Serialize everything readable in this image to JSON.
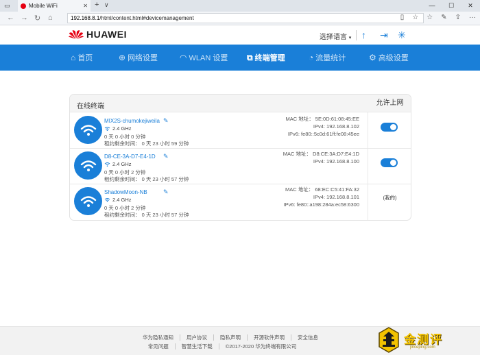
{
  "browser": {
    "tab_title": "Mobile WiFi",
    "new_tab": "+",
    "tab_menu": "∨",
    "url_host": "192.168.8.1",
    "url_path": "/html/content.html#devicemanagement"
  },
  "header": {
    "brand": "HUAWEI",
    "language_select": "选择语言",
    "brand_color": "#1a7fd8"
  },
  "nav": {
    "items": [
      {
        "label": "首页",
        "icon": "home-icon"
      },
      {
        "label": "网络设置",
        "icon": "globe-icon"
      },
      {
        "label": "WLAN 设置",
        "icon": "wifi-icon"
      },
      {
        "label": "终端管理",
        "icon": "devices-icon",
        "active": true
      },
      {
        "label": "流量统计",
        "icon": "traffic-icon"
      },
      {
        "label": "高级设置",
        "icon": "gear-icon"
      }
    ]
  },
  "devices": {
    "title": "在线终端",
    "allow_header": "允许上网",
    "rows": [
      {
        "name": "MIX2S-chumokejiweila",
        "band": "2.4 GHz",
        "online": "0 天 0 小时 0 分钟",
        "lease": "租约剩余时间： 0 天 23 小时 59 分钟",
        "mac": "MAC 地址： 5E:0D:61:08:45:EE",
        "ipv4": "IPv4: 192.168.8.102",
        "ipv6": "IPv6: fe80::5c0d:61ff:fe08:45ee",
        "allowed": true
      },
      {
        "name": "D8-CE-3A-D7-E4-1D",
        "band": "2.4 GHz",
        "online": "0 天 0 小时 2 分钟",
        "lease": "租约剩余时间： 0 天 23 小时 57 分钟",
        "mac": "MAC 地址： D8:CE:3A:D7:E4:1D",
        "ipv4": "IPv4: 192.168.8.100",
        "ipv6": "",
        "allowed": true
      },
      {
        "name": "ShadowMoon-NB",
        "band": "2.4 GHz",
        "online": "0 天 0 小时 2 分钟",
        "lease": "租约剩余时间： 0 天 23 小时 57 分钟",
        "mac": "MAC 地址： 68:EC:C5:41:FA:32",
        "ipv4": "IPv4: 192.168.8.101",
        "ipv6": "IPv6: fe80::a198:284a:ec58:6300",
        "self_label": "(我的)"
      }
    ]
  },
  "footer": {
    "row1": [
      "华为隐私通知",
      "用户协议",
      "隐私声明",
      "开源软件声明",
      "安全信息"
    ],
    "row2": [
      "常见问题",
      "智慧生活下载",
      "©2017-2020 华为终端有限公司"
    ]
  },
  "watermark": {
    "text": "金测评",
    "sub": "jinceping.com"
  }
}
